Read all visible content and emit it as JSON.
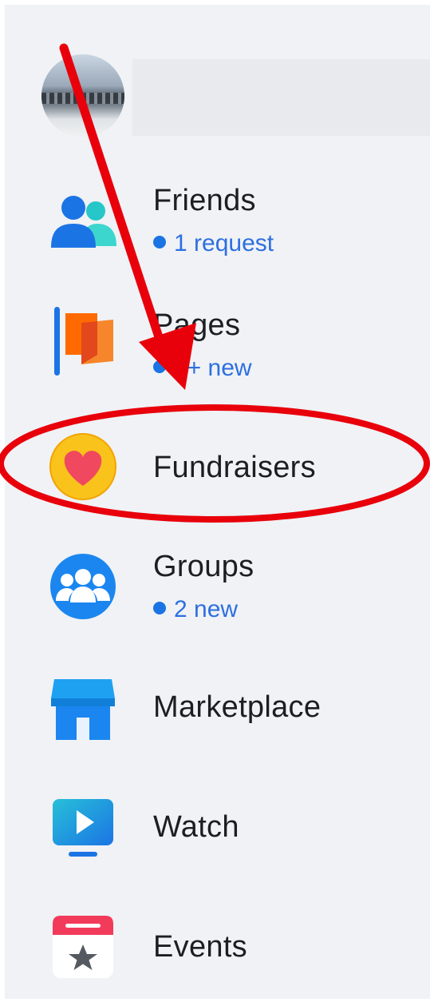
{
  "nav": {
    "friends": {
      "label": "Friends",
      "sub": "1 request"
    },
    "pages": {
      "label": "Pages",
      "sub": "9+ new"
    },
    "fundraisers": {
      "label": "Fundraisers"
    },
    "groups": {
      "label": "Groups",
      "sub": "2 new"
    },
    "marketplace": {
      "label": "Marketplace"
    },
    "watch": {
      "label": "Watch"
    },
    "events": {
      "label": "Events"
    }
  },
  "colors": {
    "accent": "#1b74e4",
    "annotation": "#e8000b",
    "sidebar_bg": "#f0f2f5"
  }
}
